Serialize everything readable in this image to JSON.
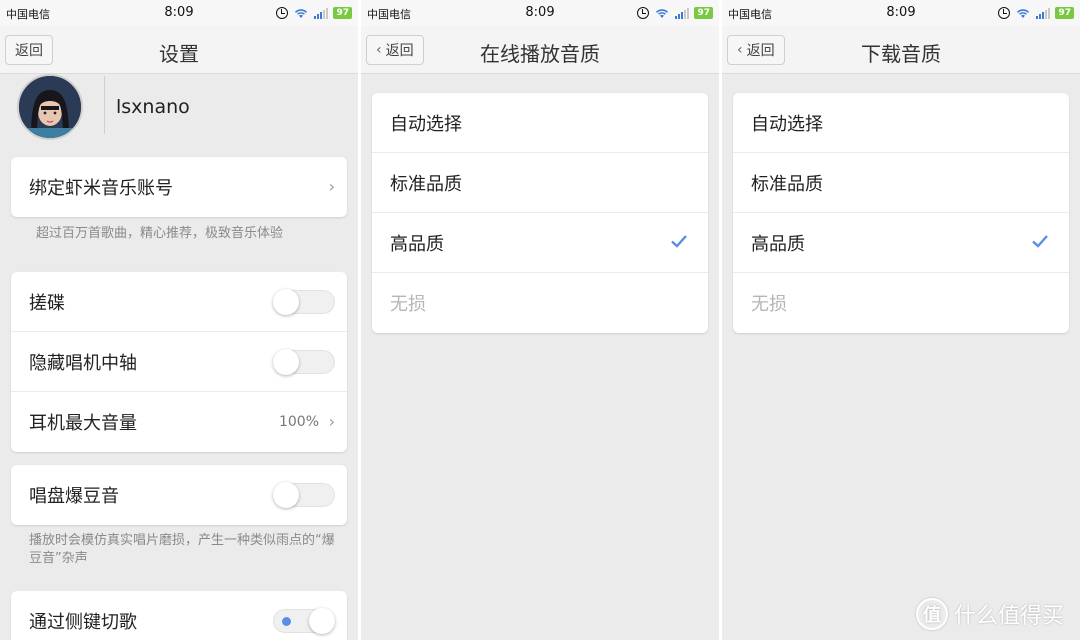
{
  "colors": {
    "accent": "#5a8ee6",
    "battery": "#7ac943",
    "background": "#ebebeb",
    "card": "#ffffff"
  },
  "statusbar": {
    "carrier": "中国电信",
    "time": "8:09",
    "battery": "97",
    "icons": [
      "alarm-icon",
      "wifi-icon",
      "signal-icon",
      "battery-icon"
    ]
  },
  "screen1": {
    "back_label": "返回",
    "title": "设置",
    "username": "lsxnano",
    "bind_account": "绑定虾米音乐账号",
    "bind_hint": "超过百万首歌曲，精心推荐，极致音乐体验",
    "scratch": "搓碟",
    "hide_spindle": "隐藏唱机中轴",
    "max_volume": "耳机最大音量",
    "max_volume_value": "100%",
    "crackle": "唱盘爆豆音",
    "crackle_hint": "播放时会模仿真实唱片磨损，产生一种类似雨点的“爆豆音”杂声",
    "side_key": "通过侧键切歌",
    "toggles": {
      "scratch": false,
      "hide_spindle": false,
      "crackle": false,
      "side_key": true
    }
  },
  "screen2": {
    "back_label": "返回",
    "title": "在线播放音质",
    "options": [
      "自动选择",
      "标准品质",
      "高品质",
      "无损"
    ],
    "selected": "高品质",
    "disabled": "无损"
  },
  "screen3": {
    "back_label": "返回",
    "title": "下载音质",
    "options": [
      "自动选择",
      "标准品质",
      "高品质",
      "无损"
    ],
    "selected": "高品质",
    "disabled": "无损"
  },
  "watermark": {
    "logo": "值",
    "text": "什么值得买"
  }
}
